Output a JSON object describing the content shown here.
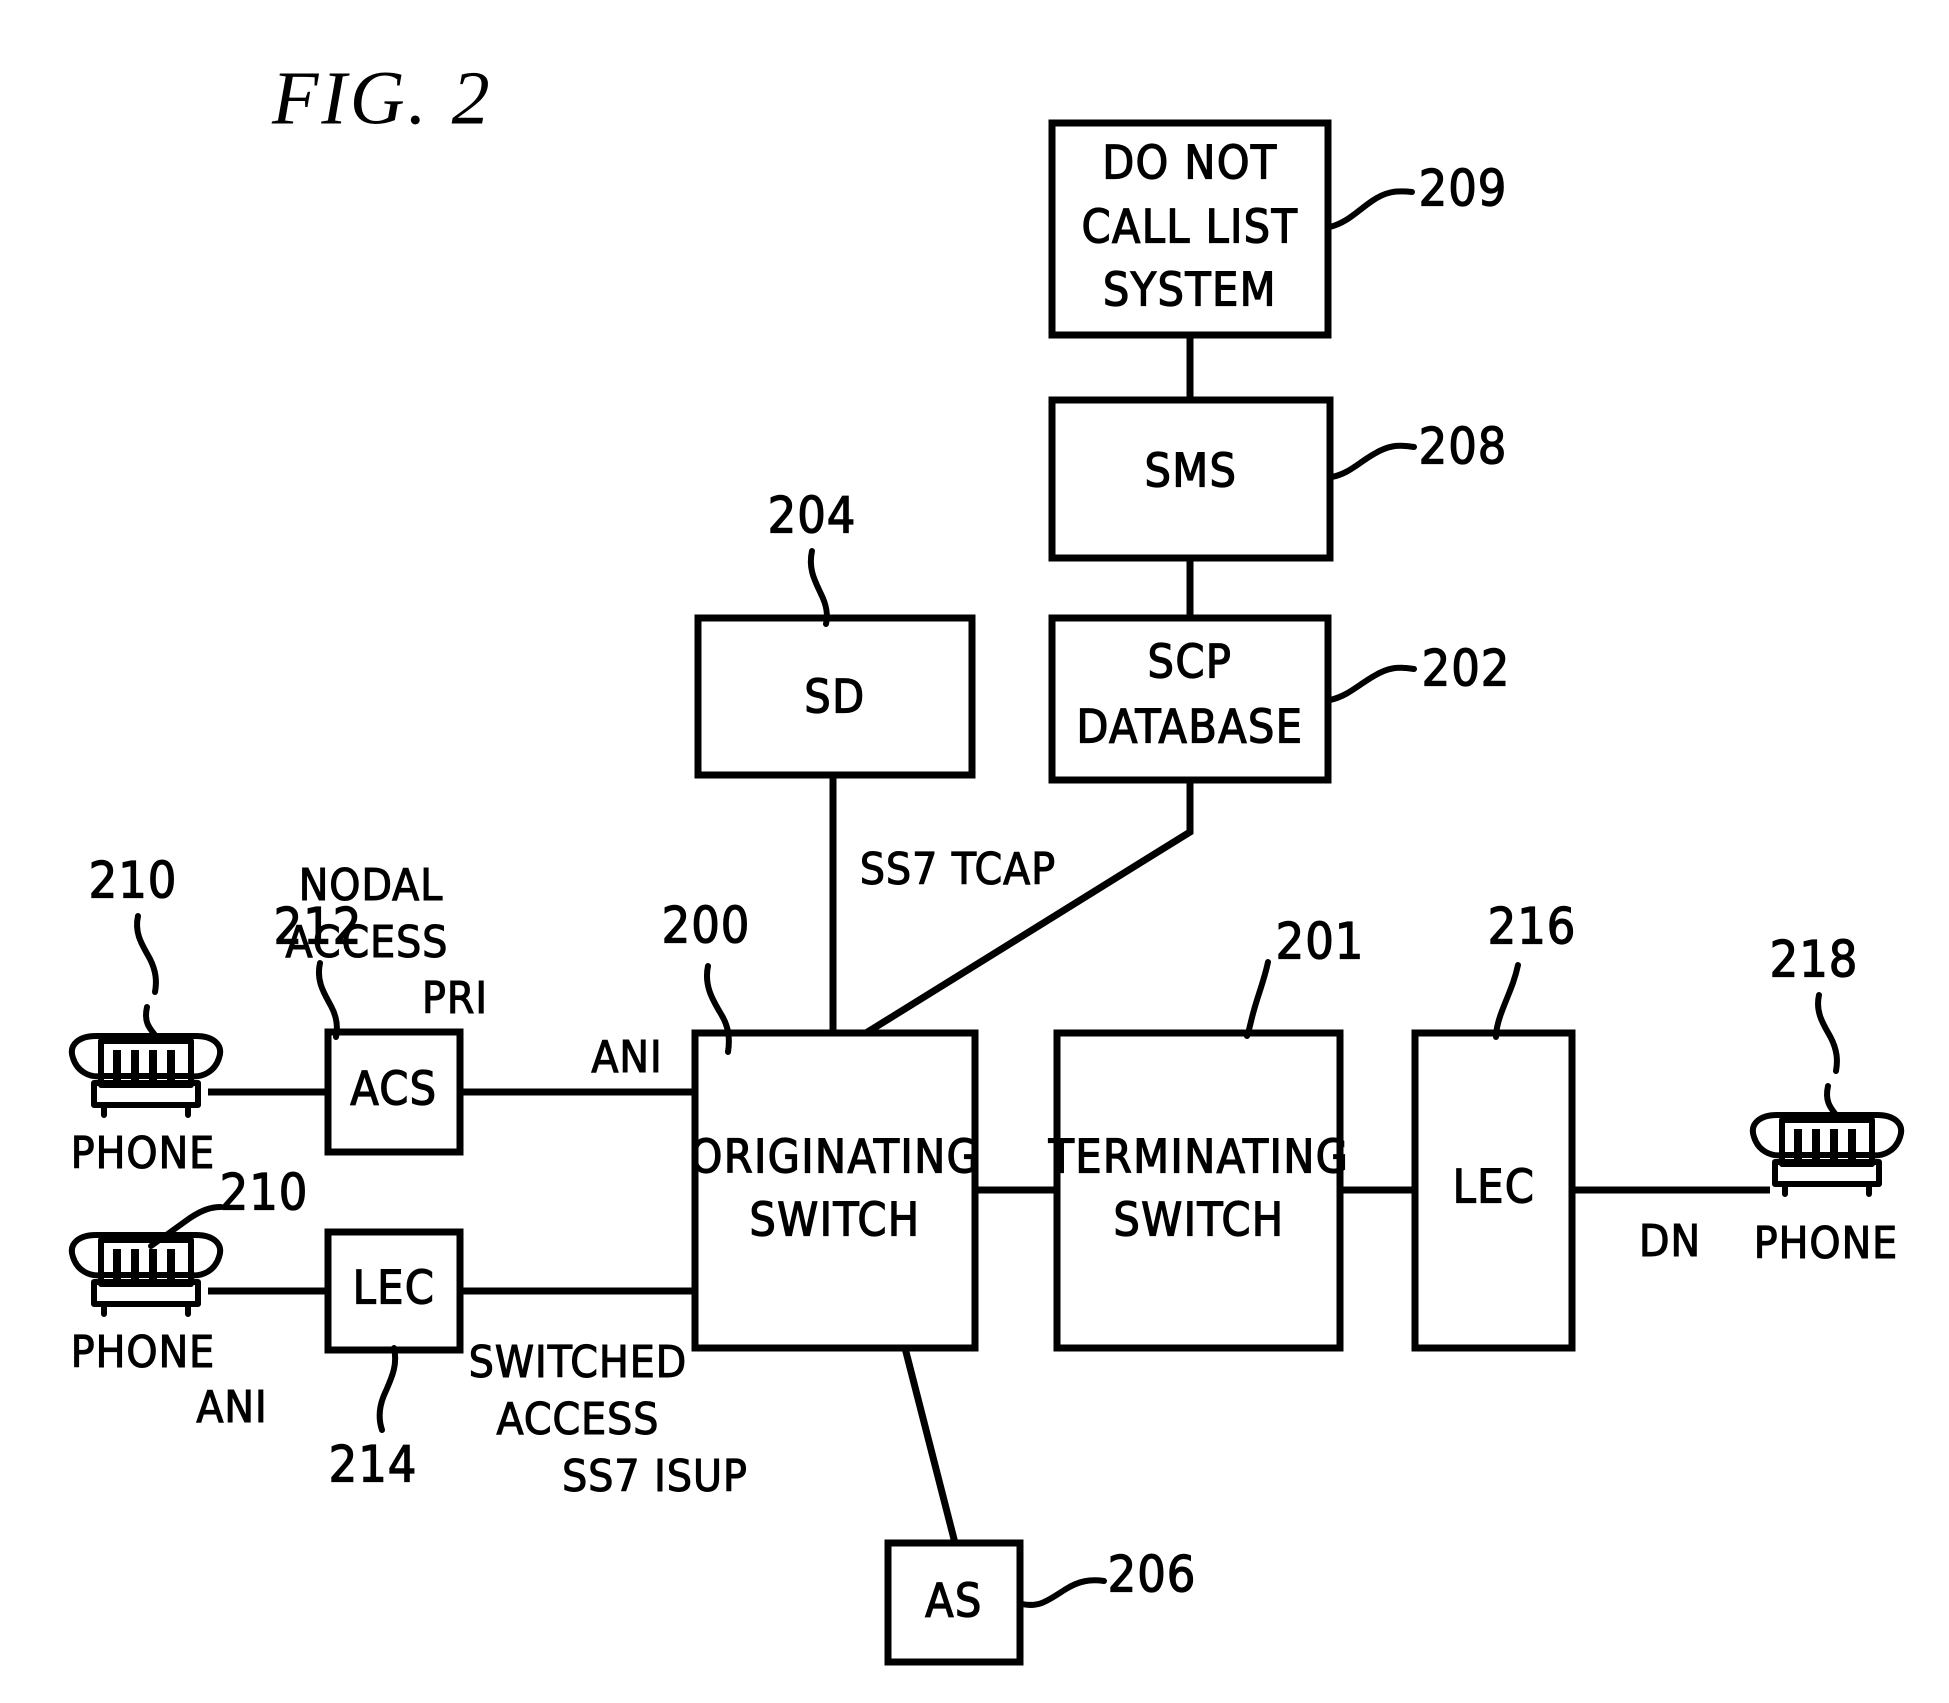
{
  "figure": {
    "title": "FIG. 2"
  },
  "boxes": {
    "do_not_call_list_system": {
      "label_line1": "DO NOT",
      "label_line2": "CALL LIST",
      "label_line3": "SYSTEM",
      "ref": "209"
    },
    "sms": {
      "label": "SMS",
      "ref": "208"
    },
    "scp_database": {
      "label_line1": "SCP",
      "label_line2": "DATABASE",
      "ref": "202"
    },
    "sd": {
      "label": "SD",
      "ref": "204"
    },
    "acs": {
      "label": "ACS",
      "ref": "212"
    },
    "lec_left": {
      "label": "LEC",
      "ref": "214"
    },
    "originating_switch": {
      "label_line1": "ORIGINATING",
      "label_line2": "SWITCH",
      "ref": "200"
    },
    "terminating_switch": {
      "label_line1": "TERMINATING",
      "label_line2": "SWITCH",
      "ref": "201"
    },
    "lec_right": {
      "label": "LEC",
      "ref": "216"
    },
    "as": {
      "label": "AS",
      "ref": "206"
    }
  },
  "phones": {
    "phone_top_left": {
      "label": "PHONE",
      "ref": "210"
    },
    "phone_bottom_left": {
      "label": "PHONE",
      "ref": "210"
    },
    "phone_right": {
      "label": "PHONE",
      "ref": "218"
    }
  },
  "link_labels": {
    "nodal": "NODAL",
    "access_top": "ACCESS",
    "pri": "PRI",
    "ani_top": "ANI",
    "ani_bottom": "ANI",
    "switched": "SWITCHED",
    "access_bottom": "ACCESS",
    "ss7_isup": "SS7  ISUP",
    "ss7_tcap": "SS7  TCAP",
    "dn": "DN"
  },
  "colors": {
    "ink": "#000000",
    "paper": "#ffffff"
  }
}
